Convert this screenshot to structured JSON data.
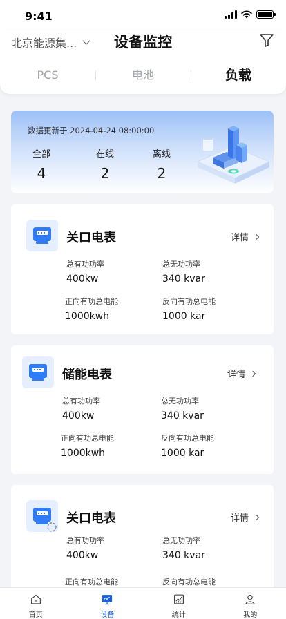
{
  "status_bar": {
    "time": "9:41"
  },
  "header": {
    "org_name": "北京能源集...",
    "title": "设备监控",
    "tabs": [
      {
        "label": "PCS",
        "active": false
      },
      {
        "label": "电池",
        "active": false
      },
      {
        "label": "负载",
        "active": true
      }
    ]
  },
  "summary": {
    "updated": "数据更新于 2024-04-24 08:00:00",
    "stats": [
      {
        "label": "全部",
        "value": "4"
      },
      {
        "label": "在线",
        "value": "2"
      },
      {
        "label": "离线",
        "value": "2"
      }
    ]
  },
  "devices": [
    {
      "name": "关口电表",
      "detail": "详情",
      "metrics": [
        {
          "label": "总有功功率",
          "value": "400kw"
        },
        {
          "label": "总无功功率",
          "value": "340 kvar"
        },
        {
          "label": "正向有功总电能",
          "value": "1000kwh"
        },
        {
          "label": "反向有功总电能",
          "value": "1000 kar"
        }
      ]
    },
    {
      "name": "储能电表",
      "detail": "详情",
      "metrics": [
        {
          "label": "总有功功率",
          "value": "400kw"
        },
        {
          "label": "总无功功率",
          "value": "340 kvar"
        },
        {
          "label": "正向有功总电能",
          "value": "1000kwh"
        },
        {
          "label": "反向有功总电能",
          "value": "1000 kar"
        }
      ]
    },
    {
      "name": "关口电表",
      "detail": "详情",
      "metrics": [
        {
          "label": "总有功功率",
          "value": "400kw"
        },
        {
          "label": "总无功功率",
          "value": "340 kvar"
        },
        {
          "label": "正向有功总电能",
          "value": ""
        },
        {
          "label": "反向有功总电能",
          "value": ""
        }
      ]
    }
  ],
  "bottom_nav": [
    {
      "label": "首页",
      "icon": "home-icon",
      "active": false
    },
    {
      "label": "设备",
      "icon": "monitor-icon",
      "active": true
    },
    {
      "label": "统计",
      "icon": "chart-icon",
      "active": false
    },
    {
      "label": "我的",
      "icon": "user-icon",
      "active": false
    }
  ],
  "colors": {
    "accent": "#1a5fd6",
    "background": "#f2f4f7",
    "icon_bg": "#e6efff"
  }
}
